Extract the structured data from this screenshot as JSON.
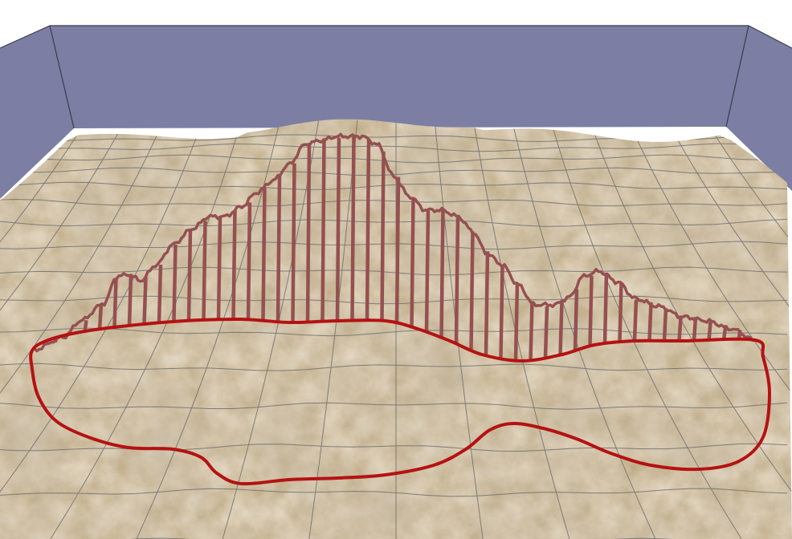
{
  "scene": {
    "colors": {
      "background": "#ffffff",
      "wall": "#7c7fa3",
      "wall_edge": "#3a3a4a",
      "ground_light": "#cbb692",
      "ground_mid": "#bca780",
      "ground_dark": "#a38f6a",
      "grid_line": "#6f6f6f",
      "loop_curve": "#b51212",
      "profile_line": "#955050"
    },
    "icons": {
      "loop": "closed-curve-shape",
      "profile": "vertical-stripe-profile-shape"
    }
  }
}
